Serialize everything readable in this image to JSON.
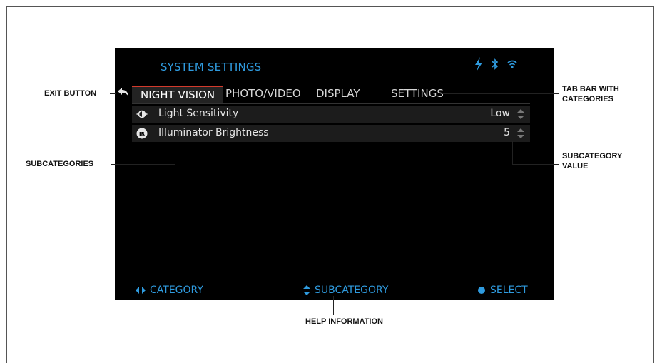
{
  "screen": {
    "title": "SYSTEM SETTINGS",
    "status_icons": [
      "lightning-icon",
      "bluetooth-icon",
      "wifi-icon"
    ],
    "tabs": [
      {
        "label": "NIGHT VISION",
        "active": true
      },
      {
        "label": "PHOTO/VIDEO",
        "active": false
      },
      {
        "label": "DISPLAY",
        "active": false
      },
      {
        "label": "SETTINGS",
        "active": false
      }
    ],
    "rows": [
      {
        "label": "Light Sensitivity",
        "value": "Low",
        "icon": "light-sensitivity-icon"
      },
      {
        "label": "Illuminator Brightness",
        "value": "5",
        "icon": "ir-icon"
      }
    ],
    "help": {
      "category": "CATEGORY",
      "subcategory": "SUBCATEGORY",
      "select": "SELECT"
    },
    "colors": {
      "accent": "#2f9bdf",
      "active_tab_line": "#d33a2c",
      "background": "#000000"
    }
  },
  "annotations": {
    "exit_button": "EXIT BUTTON",
    "subcategories": "SUBCATEGORIES",
    "help_information": "HELP INFORMATION",
    "tab_bar_1": "TAB BAR WITH",
    "tab_bar_2": "CATEGORIES",
    "subcategory_value_1": "SUBCATEGORY",
    "subcategory_value_2": "VALUE"
  }
}
